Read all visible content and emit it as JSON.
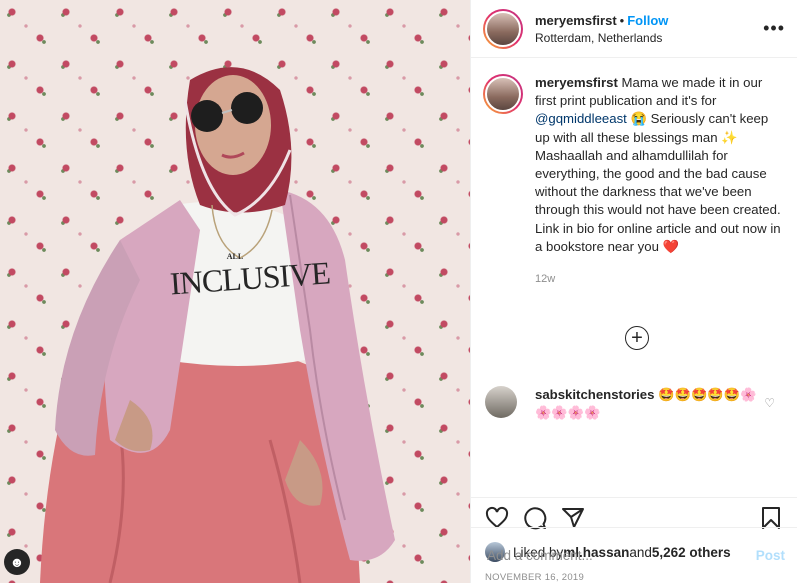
{
  "header": {
    "username": "meryemsfirst",
    "separator": "•",
    "follow_label": "Follow",
    "location": "Rotterdam, Netherlands",
    "more_icon": "more-horizontal-icon"
  },
  "caption": {
    "username": "meryemsfirst",
    "text_1": " Mama we made it in our first print publication and it's for ",
    "mention": "@gqmiddleeast",
    "text_2": " 😭 Seriously can't keep up with all these blessings man ✨ Mashaallah and alhamdullilah for everything, the good and the bad cause without the darkness that we've been through this would not have been created. Link in bio for online article and out now in a bookstore near you ❤️",
    "time": "12w"
  },
  "load_more_icon": "plus-circle-icon",
  "comment": {
    "username": "sabskitchenstories",
    "text": " 🤩🤩🤩🤩🤩🌸🌸🌸🌸🌸"
  },
  "actions": {
    "like_icon": "heart-icon",
    "comment_icon": "comment-icon",
    "share_icon": "share-icon",
    "save_icon": "bookmark-icon"
  },
  "likes": {
    "prefix": "Liked by ",
    "user": "ml.hassan",
    "middle": " and ",
    "count": "5,262 others"
  },
  "date": "NOVEMBER 16, 2019",
  "add_comment": {
    "placeholder": "Add a comment...",
    "post_label": "Post"
  },
  "photo": {
    "shirt_small": "ALL",
    "shirt_text": "INCLUSIVE"
  },
  "colors": {
    "accent": "#0095f6",
    "mention": "#00376b",
    "muted": "#8e8e8e",
    "post_disabled": "#b2dffc"
  }
}
